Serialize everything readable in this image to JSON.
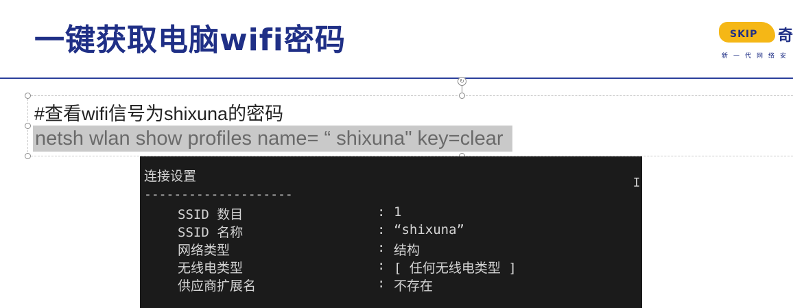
{
  "slide": {
    "title": "一键获取电脑wifi密码",
    "comment": "#查看wifi信号为shixuna的密码",
    "command": "netsh wlan show profiles name= “ shixuna\" key=clear"
  },
  "logo": {
    "mark_text": "SKIP",
    "char": "奇",
    "slogan": "新一代网络安"
  },
  "console": {
    "heading": "连接设置",
    "separator": "--------------------",
    "cursor": "I",
    "rows": [
      {
        "label": "SSID 数目",
        "colon": ":",
        "value": "1"
      },
      {
        "label": "SSID 名称",
        "colon": ":",
        "value": "“shixuna”"
      },
      {
        "label": "网络类型",
        "colon": ":",
        "value": "结构"
      },
      {
        "label": "无线电类型",
        "colon": ":",
        "value": "[ 任何无线电类型 ]"
      },
      {
        "label": "供应商扩展名",
        "colon": ":",
        "value": "不存在"
      }
    ]
  },
  "colors": {
    "title": "#1f2f86",
    "rule": "#2a3f9b",
    "comment": "#222222",
    "command": "#6a6a6a",
    "command_highlight": "#c9c9c9",
    "console_bg": "#1b1b1b",
    "console_text": "#d4d4d4",
    "logo_yellow": "#f5b716",
    "logo_blue": "#1f2f86"
  }
}
